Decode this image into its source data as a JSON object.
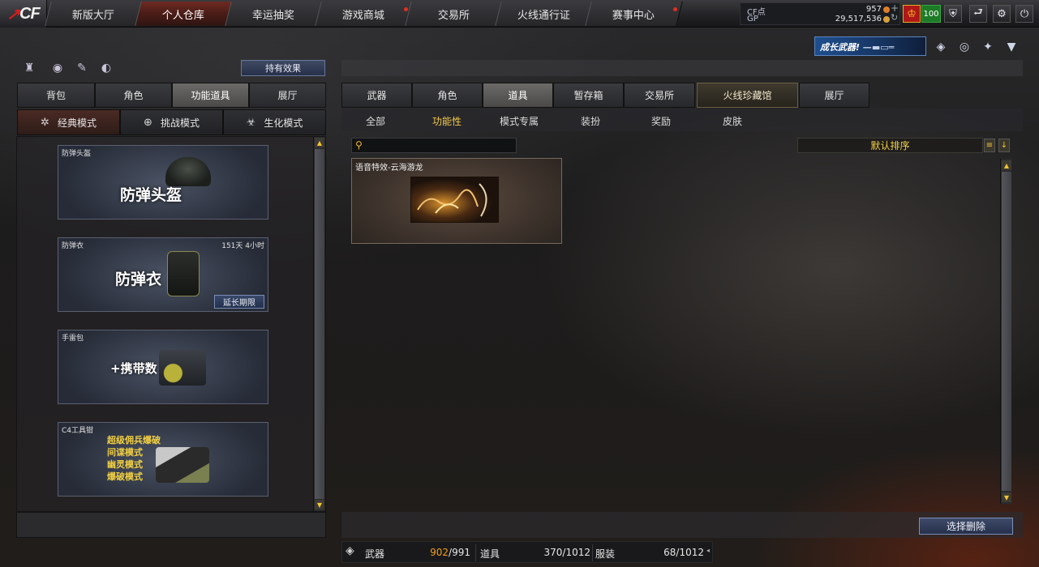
{
  "nav": {
    "logo": "CF",
    "tabs": [
      {
        "label": "新版大厅"
      },
      {
        "label": "个人仓库"
      },
      {
        "label": "幸运抽奖"
      },
      {
        "label": "游戏商城"
      },
      {
        "label": "交易所"
      },
      {
        "label": "火线通行证"
      },
      {
        "label": "赛事中心"
      }
    ],
    "active_tab": "个人仓库"
  },
  "currency": {
    "cf_label": "CF点",
    "cf_value": "957",
    "gp_label": "GP",
    "gp_value": "29,517,536"
  },
  "header_icons": {
    "level_badge": "100"
  },
  "banner": {
    "text": "成长武器!"
  },
  "left": {
    "hold_effect_button": "持有效果",
    "tabs": [
      "背包",
      "角色",
      "功能道具",
      "展厅"
    ],
    "active_tab": "功能道具",
    "modes": [
      "经典模式",
      "挑战模式",
      "生化模式"
    ],
    "active_mode": "经典模式",
    "cards": [
      {
        "title": "防弹头盔",
        "name": "防弹头盔"
      },
      {
        "title": "防弹衣",
        "name": "防弹衣",
        "timer": "151天 4小时",
        "button": "延长期限"
      },
      {
        "title": "手雷包",
        "name": "+携带数"
      },
      {
        "title": "C4工具钳",
        "modes": [
          "超级佣兵爆破",
          "间谍模式",
          "幽灵模式",
          "爆破模式"
        ]
      }
    ]
  },
  "right": {
    "tabs": [
      "武器",
      "角色",
      "道具",
      "暂存箱",
      "交易所",
      "火线珍藏馆",
      "展厅"
    ],
    "active_tab": "道具",
    "subtabs": [
      "全部",
      "功能性",
      "模式专属",
      "装扮",
      "奖励",
      "皮肤"
    ],
    "active_subtab": "功能性",
    "search": {
      "placeholder": ""
    },
    "sort": "默认排序",
    "items": [
      {
        "title": "语音特效-云海游龙"
      }
    ],
    "delete_button": "选择删除"
  },
  "capacity": {
    "weapons_label": "武器",
    "weapons_used": "902",
    "weapons_total": "/991",
    "items_label": "道具",
    "items_value": "370/1012",
    "outfit_label": "服装",
    "outfit_value": "68/1012"
  },
  "colors": {
    "accent_gold": "#f2c94c",
    "active_nav": "#6e2a22",
    "capacity_used": "#f0a020"
  }
}
